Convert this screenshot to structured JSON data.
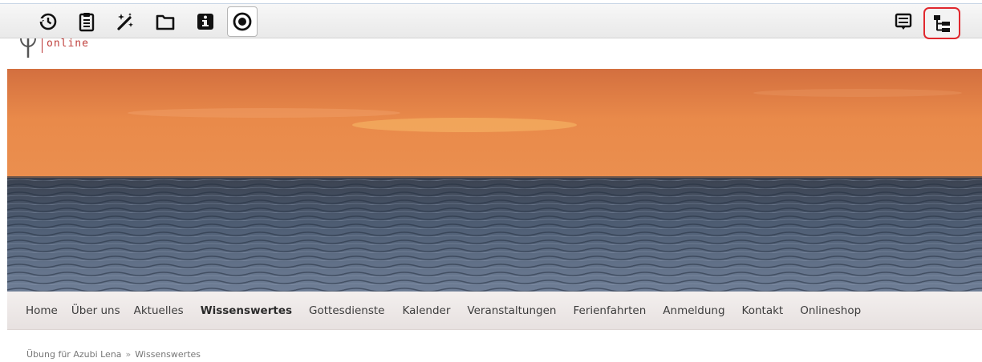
{
  "toolbar": {
    "left_icons": [
      "history-icon",
      "clipboard-icon",
      "magic-wand-icon",
      "folder-icon",
      "info-icon",
      "target-icon"
    ],
    "right_icons": [
      "list-icon",
      "tree-structure-icon"
    ],
    "active_icon": "target-icon",
    "highlighted_icon": "tree-structure-icon",
    "highlight_color": "#e0282e"
  },
  "logo": {
    "text": "online"
  },
  "hero": {
    "description_colors": {
      "sky_top": "#de7a44",
      "sun": "#f7b94f",
      "sea": "#3c4656"
    }
  },
  "nav": {
    "items": [
      "Home",
      "Über uns",
      "Aktuelles",
      "Wissenswertes",
      "Gottesdienste",
      "Kalender",
      "Veranstaltungen",
      "Ferienfahrten",
      "Anmeldung",
      "Kontakt",
      "Onlineshop"
    ],
    "active": "Wissenswertes"
  },
  "breadcrumb": {
    "items": [
      "Übung für Azubi Lena",
      "Wissenswertes"
    ],
    "separator": "»"
  }
}
